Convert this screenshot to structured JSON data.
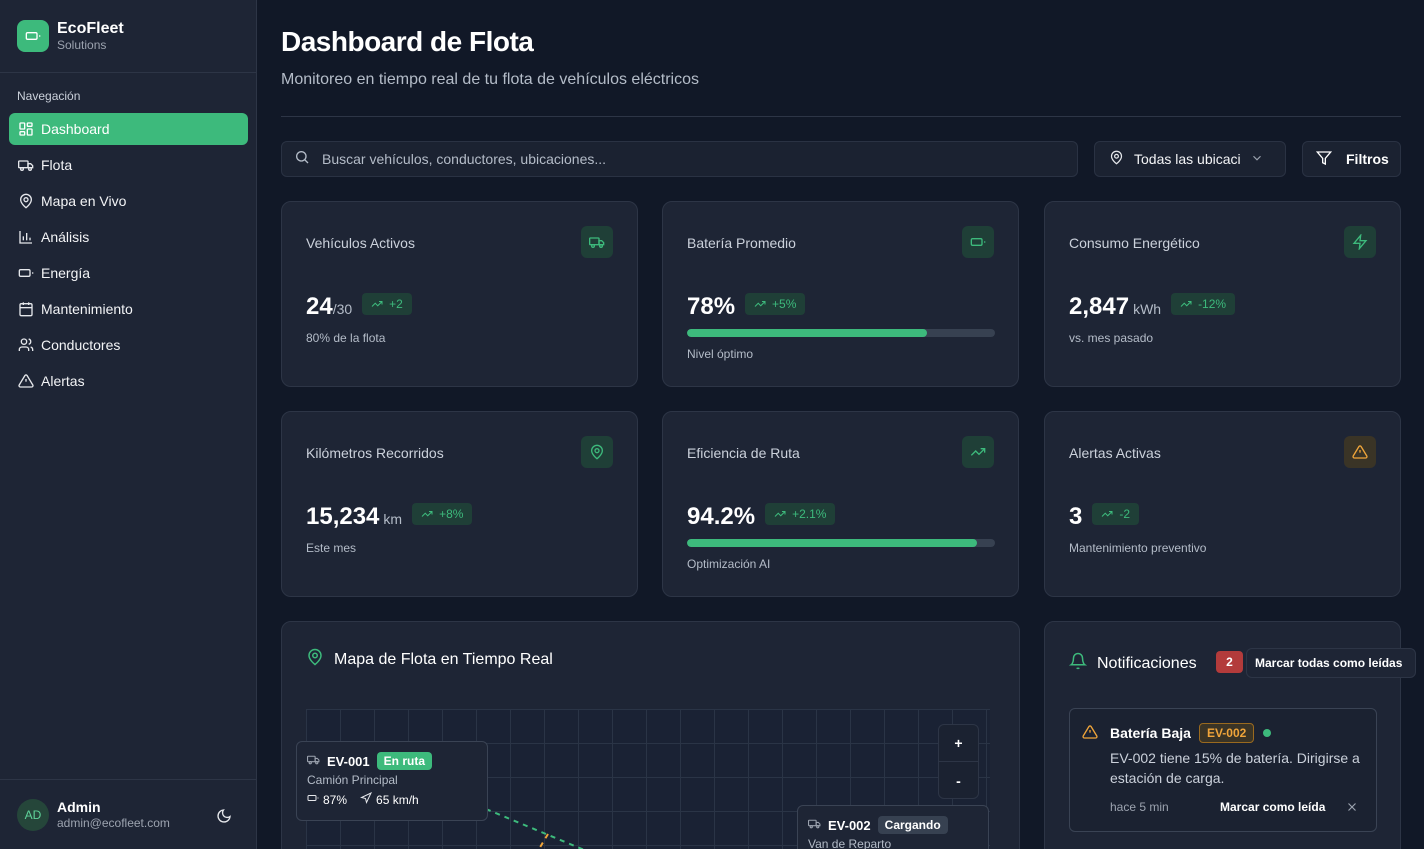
{
  "brand": {
    "name": "EcoFleet",
    "subtitle": "Solutions",
    "color": "#3dba7c"
  },
  "nav": {
    "heading": "Navegación",
    "items": [
      {
        "label": "Dashboard",
        "icon": "grid-icon",
        "active": true
      },
      {
        "label": "Flota",
        "icon": "truck-icon"
      },
      {
        "label": "Mapa en Vivo",
        "icon": "map-pin-icon"
      },
      {
        "label": "Análisis",
        "icon": "bar-chart-icon"
      },
      {
        "label": "Energía",
        "icon": "battery-icon"
      },
      {
        "label": "Mantenimiento",
        "icon": "calendar-icon"
      },
      {
        "label": "Conductores",
        "icon": "users-icon"
      },
      {
        "label": "Alertas",
        "icon": "alert-triangle-icon"
      }
    ]
  },
  "user": {
    "initials": "AD",
    "name": "Admin",
    "email": "admin@ecofleet.com"
  },
  "header": {
    "title": "Dashboard de Flota",
    "subtitle": "Monitoreo en tiempo real de tu flota de vehículos eléctricos"
  },
  "toolbar": {
    "search_placeholder": "Buscar vehículos, conductores, ubicaciones...",
    "location_value": "Todas las ubicaci",
    "filters_label": "Filtros"
  },
  "stats": [
    {
      "title": "Vehículos Activos",
      "value": "24",
      "unit": "/30",
      "trend": "+2",
      "note": "80% de la flota",
      "icon": "truck-icon"
    },
    {
      "title": "Batería Promedio",
      "value": "78%",
      "unit": "",
      "trend": "+5%",
      "note": "Nivel óptimo",
      "icon": "battery-icon",
      "progress": 0.78
    },
    {
      "title": "Consumo Energético",
      "value": "2,847",
      "unit": "kWh",
      "trend": "-12%",
      "note": "vs. mes pasado",
      "icon": "zap-icon"
    },
    {
      "title": "Kilómetros Recorridos",
      "value": "15,234",
      "unit": "km",
      "trend": "+8%",
      "note": "Este mes",
      "icon": "map-pin-icon"
    },
    {
      "title": "Eficiencia de Ruta",
      "value": "94.2%",
      "unit": "",
      "trend": "+2.1%",
      "note": "Optimización AI",
      "icon": "trending-up-icon",
      "progress": 0.942
    },
    {
      "title": "Alertas Activas",
      "value": "3",
      "unit": "",
      "trend": "-2",
      "note": "Mantenimiento preventivo",
      "icon": "alert-triangle-icon"
    }
  ],
  "map": {
    "title": "Mapa de Flota en Tiempo Real",
    "zoom_in": "+",
    "zoom_out": "-",
    "vehicles": [
      {
        "id": "EV-001",
        "status": "En ruta",
        "type": "Camión Principal",
        "battery": "87%",
        "speed": "65 km/h"
      },
      {
        "id": "EV-002",
        "status": "Cargando",
        "type": "Van de Reparto"
      }
    ]
  },
  "notifications": {
    "title": "Notificaciones",
    "count": "2",
    "mark_all": "Marcar todas como leídas",
    "items": [
      {
        "title": "Batería Baja",
        "tag": "EV-002",
        "message": "EV-002 tiene 15% de batería. Dirigirse a estación de carga.",
        "time": "hace 5 min",
        "action": "Marcar como leída"
      }
    ]
  }
}
